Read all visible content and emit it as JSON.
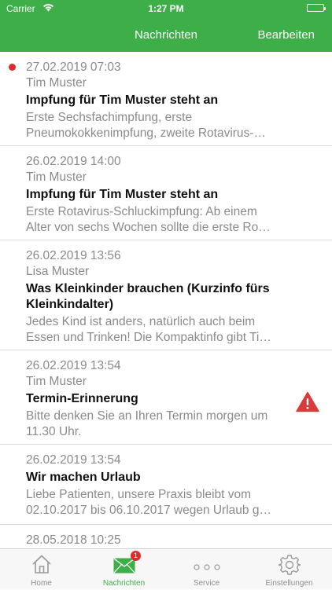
{
  "status_bar": {
    "carrier": "Carrier",
    "time": "1:27 PM"
  },
  "nav": {
    "title": "Nachrichten",
    "edit_button": "Bearbeiten"
  },
  "messages": [
    {
      "date": "27.02.2019 07:03",
      "sender": "Tim Muster",
      "title": "Impfung für Tim Muster steht an",
      "preview": "Erste Sechsfachimpfung, erste Pneumokokkenimpfung, zweite Rotavirus-…",
      "unread": true
    },
    {
      "date": "26.02.2019 14:00",
      "sender": "Tim Muster",
      "title": "Impfung für Tim Muster steht an",
      "preview": "Erste Rotavirus-Schluckimpfung:  Ab einem Alter von sechs Wochen sollte die erste Ro…",
      "unread": false
    },
    {
      "date": "26.02.2019 13:56",
      "sender": "Lisa Muster",
      "title": "Was Kleinkinder brauchen (Kurzinfo fürs Kleinkindalter)",
      "preview": "Jedes Kind ist anders, natürlich auch beim Essen und Trinken! Die Kompaktinfo gibt Ti…",
      "unread": false
    },
    {
      "date": "26.02.2019 13:54",
      "sender": "Tim Muster",
      "title": "Termin-Erinnerung",
      "preview": "Bitte denken Sie an Ihren Termin morgen um 11.30 Uhr.",
      "unread": false,
      "icon": "warning-icon"
    },
    {
      "date": "26.02.2019 13:54",
      "title": "Wir machen Urlaub",
      "preview": "Liebe Patienten, unsere Praxis bleibt vom 02.10.2017 bis 06.10.2017 wegen Urlaub g…",
      "unread": false
    },
    {
      "date": "28.05.2018 10:25"
    }
  ],
  "tabs": [
    {
      "label": "Home",
      "icon": "home-icon"
    },
    {
      "label": "Nachrichten",
      "icon": "envelope-icon",
      "badge": "1",
      "active": true
    },
    {
      "label": "Service",
      "icon": "more-dots-icon"
    },
    {
      "label": "Einstellungen",
      "icon": "gear-icon"
    }
  ],
  "colors": {
    "brand_green": "#3eae48",
    "unread_red": "#e02b2b",
    "secondary_text": "#8a8a8a",
    "warning_red": "#d93a3a"
  }
}
